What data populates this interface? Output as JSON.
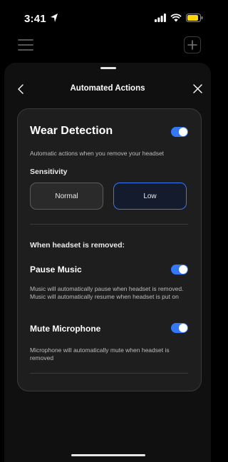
{
  "status_bar": {
    "time": "3:41",
    "icons": [
      "location-arrow-icon",
      "signal-icon",
      "wifi-icon",
      "battery-icon"
    ]
  },
  "top_bar": {
    "icons": [
      "menu-icon",
      "plus-icon"
    ]
  },
  "sheet": {
    "title": "Automated Actions",
    "icons": [
      "back-icon",
      "close-icon"
    ]
  },
  "wear_detection": {
    "title": "Wear Detection",
    "enabled": true,
    "description": "Automatic actions when you remove your headset",
    "sensitivity_label": "Sensitivity",
    "options": [
      {
        "label": "Normal",
        "selected": false
      },
      {
        "label": "Low",
        "selected": true
      }
    ]
  },
  "removed_section": {
    "heading": "When headset is removed:",
    "items": [
      {
        "title": "Pause Music",
        "enabled": true,
        "description": "Music will automatically pause when headset is removed. Music will automatically resume when headset is put on"
      },
      {
        "title": "Mute Microphone",
        "enabled": true,
        "description": "Microphone will automatically mute when headset is removed"
      }
    ]
  },
  "colors": {
    "accent": "#3478f6",
    "card_bg": "#1e1e1e",
    "sheet_bg": "#101010",
    "battery": "#ffd60a"
  }
}
